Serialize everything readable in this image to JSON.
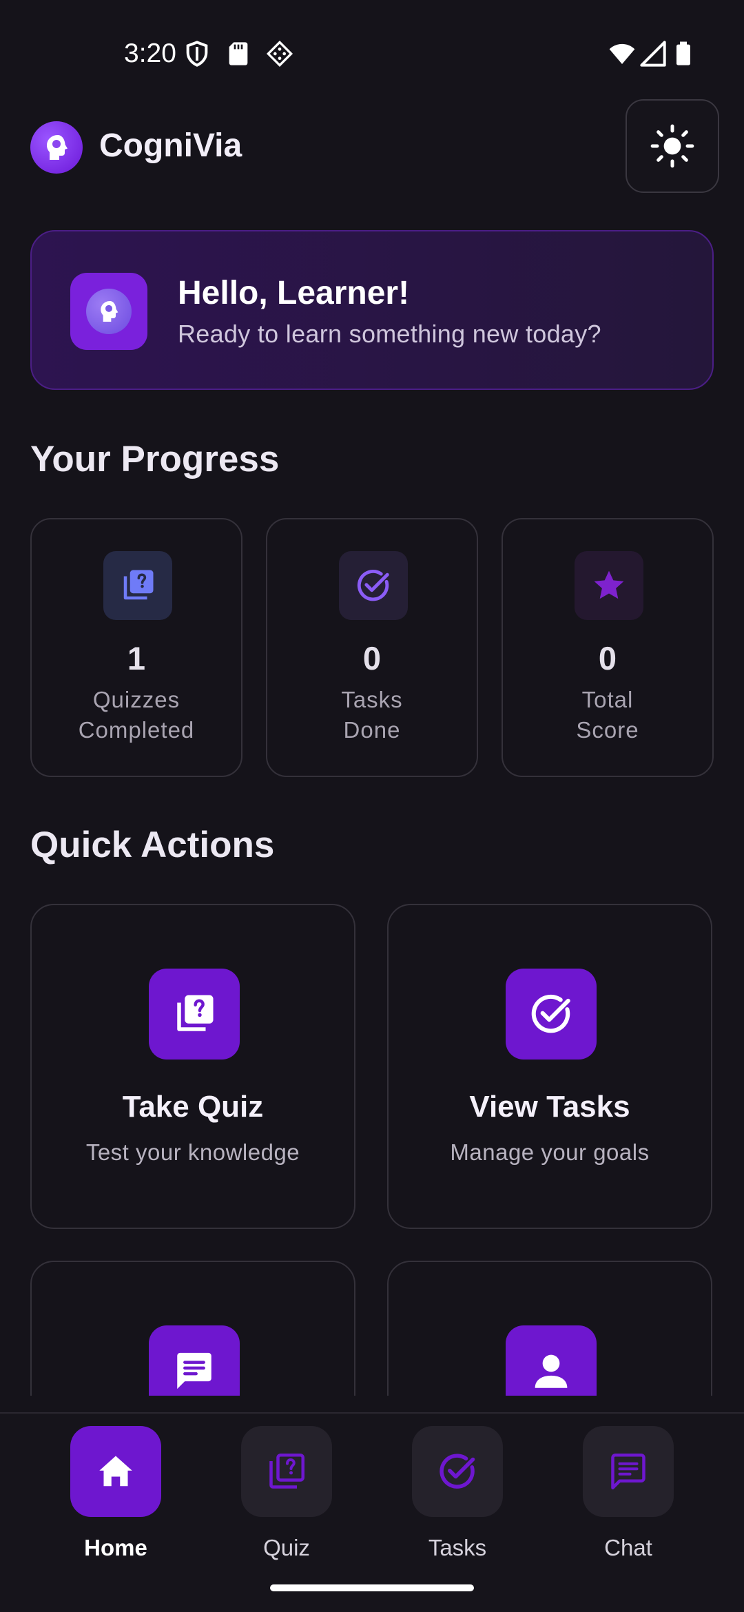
{
  "status_bar": {
    "time": "3:20",
    "left_icons": [
      "shield-icon",
      "sd-card-icon",
      "diamond-grid-icon"
    ],
    "right_icons": [
      "wifi-icon",
      "signal-icon",
      "battery-icon"
    ]
  },
  "header": {
    "app_name": "CogniVia",
    "logo_icon": "brain-head-icon",
    "theme_toggle_icon": "sun-icon"
  },
  "greeting": {
    "title": "Hello, Learner!",
    "subtitle": "Ready to learn something new today?",
    "icon": "brain-head-icon"
  },
  "progress": {
    "title": "Your Progress",
    "stats": [
      {
        "value": "1",
        "label": "Quizzes Completed",
        "icon": "quiz-icon",
        "color": "#6f7bf7"
      },
      {
        "value": "0",
        "label": "Tasks Done",
        "icon": "check-circle-icon",
        "color": "#8b5cf6"
      },
      {
        "value": "0",
        "label": "Total Score",
        "icon": "star-icon",
        "color": "#7e22ce"
      }
    ]
  },
  "quick_actions": {
    "title": "Quick Actions",
    "actions": [
      {
        "title": "Take Quiz",
        "subtitle": "Test your knowledge",
        "icon": "quiz-icon"
      },
      {
        "title": "View Tasks",
        "subtitle": "Manage your goals",
        "icon": "check-circle-icon"
      },
      {
        "icon": "chat-icon"
      },
      {
        "icon": "person-icon"
      }
    ]
  },
  "bottom_nav": {
    "items": [
      {
        "label": "Home",
        "icon": "home-icon",
        "active": true
      },
      {
        "label": "Quiz",
        "icon": "quiz-icon",
        "active": false
      },
      {
        "label": "Tasks",
        "icon": "check-circle-icon",
        "active": false
      },
      {
        "label": "Chat",
        "icon": "chat-icon",
        "active": false
      }
    ]
  },
  "colors": {
    "background": "#15131a",
    "accent": "#6e17cf",
    "card_border": "#34313a",
    "greeting_bg": "#2d1450"
  }
}
